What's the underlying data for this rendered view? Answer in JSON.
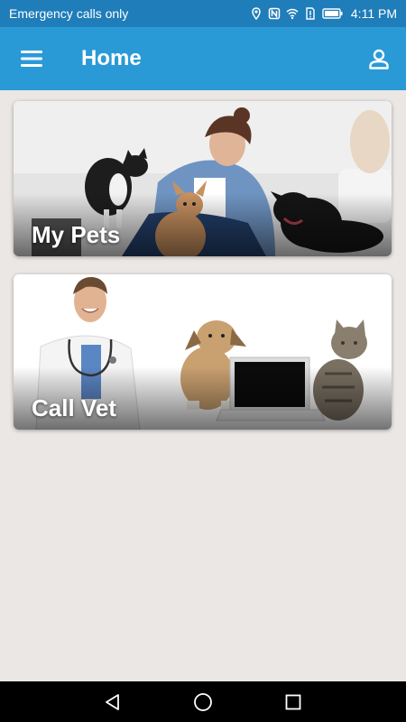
{
  "status_bar": {
    "carrier": "Emergency calls only",
    "time": "4:11 PM",
    "icons": [
      "location-icon",
      "nfc-icon",
      "wifi-icon",
      "sim-alert-icon",
      "battery-icon"
    ]
  },
  "app_bar": {
    "title": "Home",
    "menu_icon": "hamburger-menu-icon",
    "account_icon": "account-icon",
    "color": "#2a9ad7"
  },
  "cards": [
    {
      "label": "My Pets",
      "image": "woman with cat and dogs"
    },
    {
      "label": "Call Vet",
      "image": "veterinarian with dog, laptop and cat"
    }
  ],
  "nav_bar": {
    "buttons": [
      "back-icon",
      "home-icon",
      "recents-icon"
    ]
  },
  "colors": {
    "status_bar": "#1f7db9",
    "background": "#ebe7e5"
  }
}
